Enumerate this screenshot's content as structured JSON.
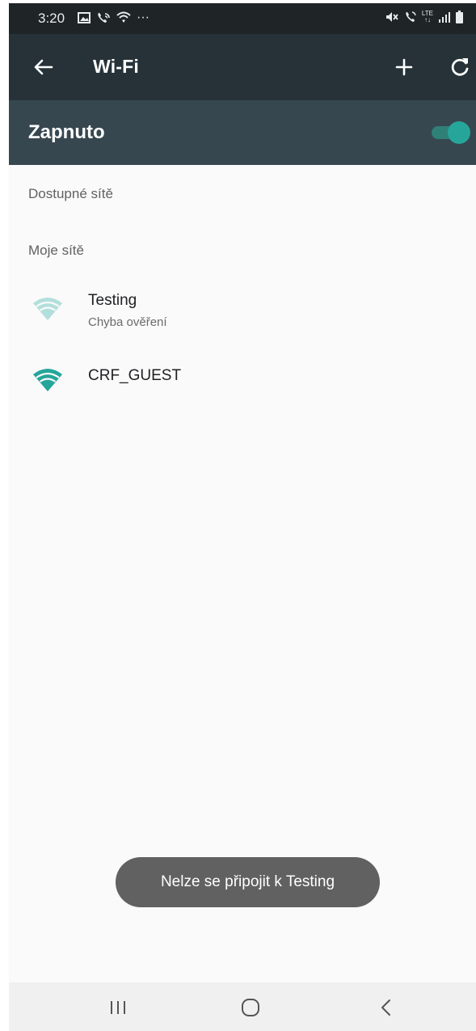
{
  "status_bar": {
    "time": "3:20",
    "left_icons": [
      "gallery-icon",
      "wifi-calling-icon",
      "wifi-status-icon",
      "more-dots-icon"
    ],
    "more": "···",
    "right_icons": [
      "mute-icon",
      "volte-call-icon",
      "lte-icon",
      "signal-icon",
      "battery-icon"
    ],
    "lte_top": "LTE",
    "lte_bottom": "↑↓"
  },
  "app_bar": {
    "title": "Wi-Fi",
    "back_icon": "arrow-back-icon",
    "add_icon": "plus-icon",
    "refresh_icon": "refresh-icon"
  },
  "master_switch": {
    "label": "Zapnuto",
    "state": "on",
    "color": "#26a69a"
  },
  "sections": {
    "available": "Dostupné sítě",
    "mine": "Moje sítě"
  },
  "networks": [
    {
      "name": "Testing",
      "status": "Chyba ověření",
      "icon": "wifi-icon-faded"
    },
    {
      "name": "CRF_GUEST",
      "status": "",
      "icon": "wifi-icon"
    }
  ],
  "toast": {
    "message": "Nelze se připojit k Testing"
  },
  "nav_bar": {
    "recent_icon": "recent-apps-icon",
    "home_icon": "home-icon",
    "back_icon": "back-icon"
  },
  "colors": {
    "status_bar": "#1f2427",
    "app_bar": "#263238",
    "master_bar": "#37474f",
    "accent": "#26a69a",
    "toast": "#616161"
  }
}
